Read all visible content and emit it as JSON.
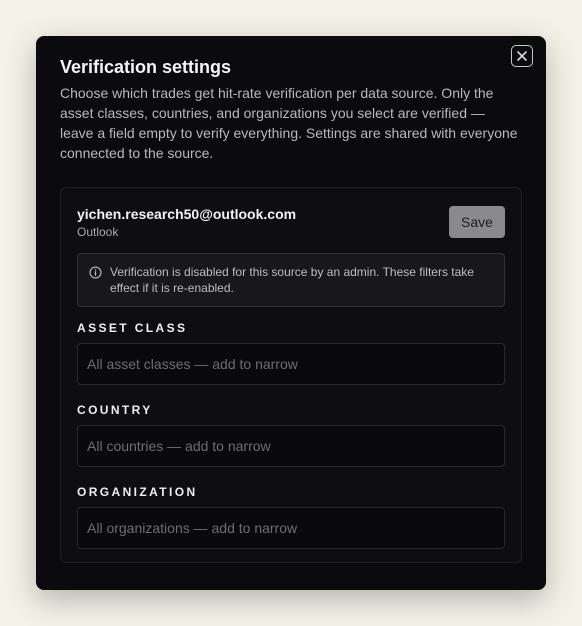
{
  "dialog": {
    "title": "Verification settings",
    "description": "Choose which trades get hit-rate verification per data source. Only the asset classes, countries, and organizations you select are verified — leave a field empty to verify everything. Settings are shared with everyone connected to the source.",
    "close_icon": "close-icon"
  },
  "source": {
    "email": "yichen.research50@outlook.com",
    "provider": "Outlook",
    "save_label": "Save",
    "notice": "Verification is disabled for this source by an admin. These filters take effect if it is re-enabled.",
    "notice_icon": "info-icon"
  },
  "fields": {
    "asset_class": {
      "label": "ASSET CLASS",
      "value": "",
      "placeholder": "All asset classes — add to narrow"
    },
    "country": {
      "label": "COUNTRY",
      "value": "",
      "placeholder": "All countries — add to narrow"
    },
    "organization": {
      "label": "ORGANIZATION",
      "value": "",
      "placeholder": "All organizations — add to narrow"
    }
  },
  "colors": {
    "page_background": "#f4f1e7",
    "modal_background": "#0b0a0c",
    "save_button": "#8a8a8e"
  }
}
